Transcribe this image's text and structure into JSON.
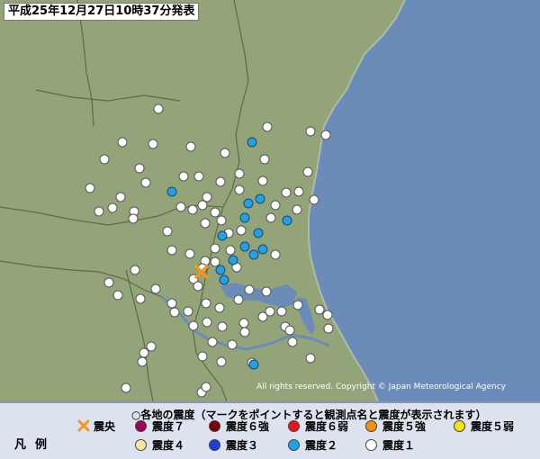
{
  "header": {
    "title": "平成25年12月27日10時37分発表"
  },
  "map": {
    "copyright": "All rights reserved. Copyright © Japan Meteorological Agency"
  },
  "legend": {
    "heading": "○各地の震度（マークをポイントすると観測点名と震度が表示されます）",
    "key_label": "凡例",
    "items": [
      {
        "label": "震央",
        "kind": "epicenter",
        "color": "#f7941d"
      },
      {
        "label": "震度７",
        "kind": "dot",
        "color": "#a0005a"
      },
      {
        "label": "震度６強",
        "kind": "dot",
        "color": "#7a0000"
      },
      {
        "label": "震度６弱",
        "kind": "dot",
        "color": "#e8141b"
      },
      {
        "label": "震度５強",
        "kind": "dot",
        "color": "#f39200"
      },
      {
        "label": "震度５弱",
        "kind": "dot",
        "color": "#f7e400"
      },
      {
        "label": "震度４",
        "kind": "dot",
        "color": "#fbe8a0"
      },
      {
        "label": "震度３",
        "kind": "dot",
        "color": "#1e3ddc"
      },
      {
        "label": "震度２",
        "kind": "dot",
        "color": "#1fa2e6"
      },
      {
        "label": "震度１",
        "kind": "dot",
        "color": "#ffffff"
      }
    ]
  },
  "colors": {
    "sea": "#6b8bb8",
    "land": "#93a578",
    "border": "#5d6b4c"
  }
}
